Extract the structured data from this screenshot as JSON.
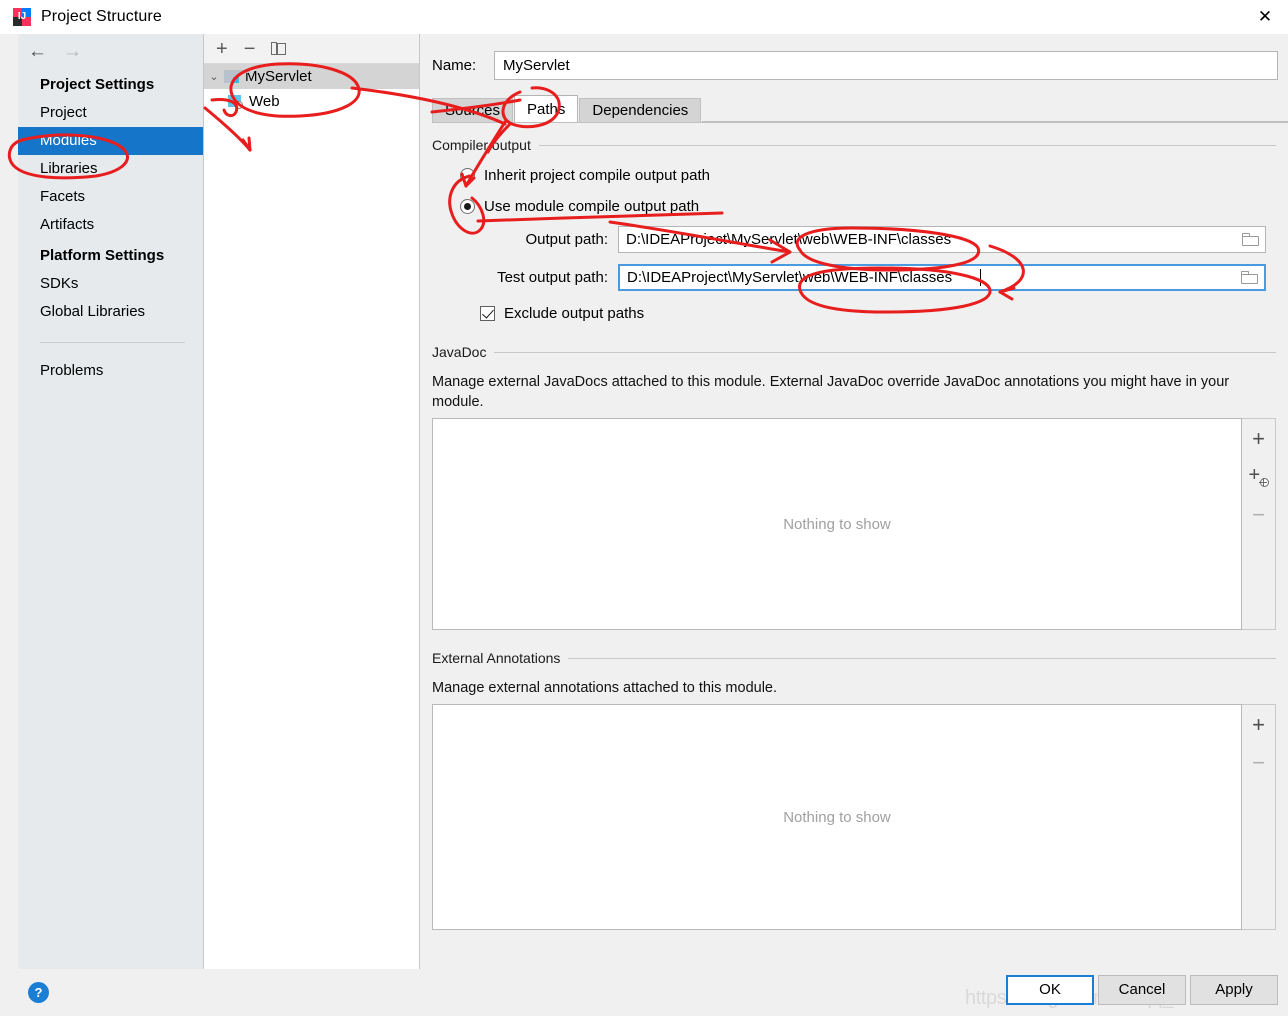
{
  "window": {
    "title": "Project Structure",
    "app_icon": "intellij-idea-icon",
    "close_label": "✕"
  },
  "sidebar": {
    "nav": {
      "back_icon": "←",
      "forward_icon": "→"
    },
    "groups": [
      {
        "title": "Project Settings",
        "items": [
          {
            "label": "Project",
            "selected": false
          },
          {
            "label": "Modules",
            "selected": true
          },
          {
            "label": "Libraries",
            "selected": false
          },
          {
            "label": "Facets",
            "selected": false
          },
          {
            "label": "Artifacts",
            "selected": false
          }
        ]
      },
      {
        "title": "Platform Settings",
        "items": [
          {
            "label": "SDKs",
            "selected": false
          },
          {
            "label": "Global Libraries",
            "selected": false
          }
        ]
      }
    ],
    "extra_items": [
      {
        "label": "Problems",
        "selected": false
      }
    ],
    "selected_color": "#1575c9"
  },
  "tree": {
    "toolbar": [
      {
        "name": "add-module-button",
        "glyph": "+"
      },
      {
        "name": "remove-module-button",
        "glyph": "−"
      },
      {
        "name": "copy-module-button",
        "glyph": "copy"
      }
    ],
    "nodes": [
      {
        "label": "MyServlet",
        "icon": "module-icon",
        "expanded": true,
        "selected": true,
        "chevron": "⌄"
      },
      {
        "label": "Web",
        "icon": "web-facet-icon",
        "expanded": false,
        "selected": false
      }
    ]
  },
  "main": {
    "name_label": "Name:",
    "name_value": "MyServlet",
    "tabs": [
      {
        "label": "Sources",
        "active": false
      },
      {
        "label": "Paths",
        "active": true
      },
      {
        "label": "Dependencies",
        "active": false
      }
    ],
    "compiler_output": {
      "group_title": "Compiler output",
      "radio_inherit": {
        "label": "Inherit project compile output path",
        "selected": false
      },
      "radio_module": {
        "label": "Use module compile output path",
        "selected": true
      },
      "output_path": {
        "label": "Output path:",
        "value": "D:\\IDEAProject\\MyServlet\\web\\WEB-INF\\classes",
        "browse_icon": "folder-icon",
        "focused": false
      },
      "test_output_path": {
        "label": "Test output path:",
        "value": "D:\\IDEAProject\\MyServlet\\web\\WEB-INF\\classes",
        "browse_icon": "folder-icon",
        "focused": true
      },
      "exclude_checkbox": {
        "label": "Exclude output paths",
        "checked": true
      }
    },
    "javadoc": {
      "group_title": "JavaDoc",
      "description": "Manage external JavaDocs attached to this module. External JavaDoc override JavaDoc annotations you might have in your module.",
      "empty_text": "Nothing to show",
      "buttons": [
        {
          "name": "add-javadoc-path-button",
          "glyph": "+",
          "enabled": true
        },
        {
          "name": "add-javadoc-url-button",
          "glyph": "+url",
          "enabled": true
        },
        {
          "name": "remove-javadoc-button",
          "glyph": "−",
          "enabled": false
        }
      ]
    },
    "external_annotations": {
      "group_title": "External Annotations",
      "description": "Manage external annotations attached to this module.",
      "empty_text": "Nothing to show",
      "buttons": [
        {
          "name": "add-annotation-path-button",
          "glyph": "+",
          "enabled": true
        },
        {
          "name": "remove-annotation-button",
          "glyph": "−",
          "enabled": false
        }
      ]
    }
  },
  "footer": {
    "help_label": "?",
    "buttons": [
      {
        "label": "OK",
        "default": true
      },
      {
        "label": "Cancel",
        "default": false
      },
      {
        "label": "Apply",
        "default": false
      }
    ],
    "watermark": "https://blog.csdn.net/qq_4    846"
  },
  "annotations": {
    "color": "#e81d1d",
    "marks": [
      "circle-around-modules-item",
      "arrow-from-modules-to-tree",
      "circle-around-myservlet-node",
      "circle-around-paths-tab",
      "circle-around-inherit-and-use-radios",
      "strikethrough-use-module-compile-output-path",
      "arrow-to-output-path",
      "circle-around-output-path-tail",
      "circle-around-test-output-path-tail",
      "arrow-from-output-to-test-output"
    ]
  }
}
